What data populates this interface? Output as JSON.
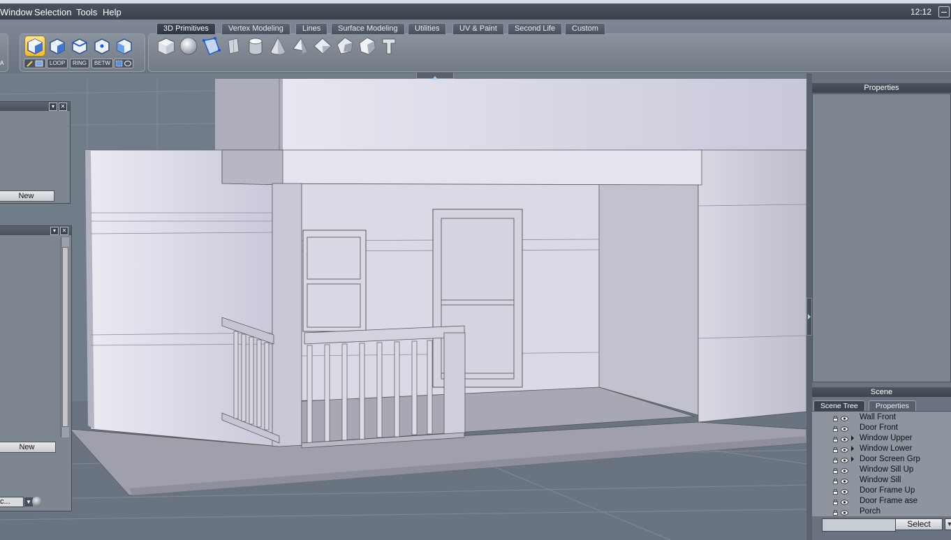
{
  "menubar": {
    "items": [
      "Window",
      "Selection",
      "Tools",
      "Help"
    ],
    "clock": "12:12"
  },
  "toolbar": {
    "tabs": [
      "3D Primitives",
      "Vertex Modeling",
      "Lines",
      "Surface Modeling",
      "Utilities",
      "UV & Paint",
      "Second Life",
      "Custom"
    ],
    "active_tab": "3D Primitives",
    "mini_buttons": [
      "LOOP",
      "RING",
      "BETW"
    ],
    "left_stub": "A",
    "primitive_icons": [
      "cube-icon",
      "sphere-icon",
      "polygon-icon",
      "plane-icon",
      "cylinder-icon",
      "cone-icon",
      "pyramid-icon",
      "octahedron-icon",
      "dodecahedron-icon",
      "geosphere-icon",
      "text-t-icon"
    ]
  },
  "left_panels": {
    "panel1_new": "New",
    "panel2_new": "New",
    "dropdown_text": "c..."
  },
  "right_panel": {
    "properties_title": "Properties",
    "scene_title": "Scene",
    "tabs": [
      "Scene Tree",
      "Properties"
    ],
    "scene_items": [
      {
        "label": "Wall Front",
        "expand": false
      },
      {
        "label": "Door Front",
        "expand": false
      },
      {
        "label": "Window Upper",
        "expand": true
      },
      {
        "label": "Window Lower",
        "expand": true
      },
      {
        "label": "Door Screen Grp",
        "expand": true
      },
      {
        "label": "Window Sill Up",
        "expand": false
      },
      {
        "label": "Window Sill",
        "expand": false
      },
      {
        "label": "Door Frame Up",
        "expand": false
      },
      {
        "label": "Door Frame ase",
        "expand": false
      },
      {
        "label": "Porch",
        "expand": false
      }
    ],
    "select_label": "Select",
    "search_value": ""
  },
  "colors": {
    "selection_accent": "#f2b933",
    "menubar_bg": "#3b414c",
    "viewport_bg": "#75808d"
  }
}
